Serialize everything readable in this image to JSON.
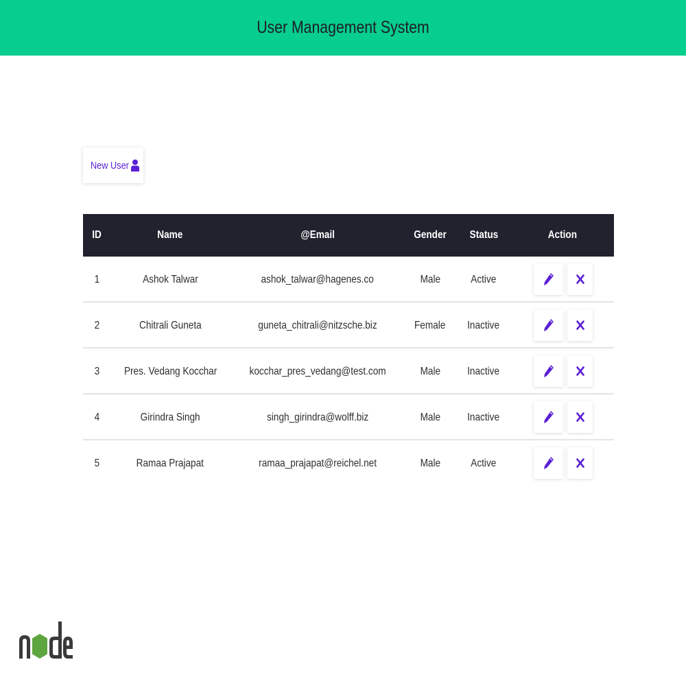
{
  "header": {
    "title": "User Management System",
    "color": "#07cd8d"
  },
  "toolbar": {
    "new_user_label": "New User",
    "new_user_icon": "user-icon",
    "accent": "#5b1fd6"
  },
  "table": {
    "columns": [
      "ID",
      "Name",
      "@Email",
      "Gender",
      "Status",
      "Action"
    ],
    "header_bg": "#21222e",
    "rows": [
      {
        "id": "1",
        "name": "Ashok Talwar",
        "email": "ashok_talwar@hagenes.co",
        "gender": "Male",
        "status": "Active"
      },
      {
        "id": "2",
        "name": "Chitrali Guneta",
        "email": "guneta_chitrali@nitzsche.biz",
        "gender": "Female",
        "status": "Inactive"
      },
      {
        "id": "3",
        "name": "Pres. Vedang Kocchar",
        "email": "kocchar_pres_vedang@test.com",
        "gender": "Male",
        "status": "Inactive"
      },
      {
        "id": "4",
        "name": "Girindra Singh",
        "email": "singh_girindra@wolff.biz",
        "gender": "Male",
        "status": "Inactive"
      },
      {
        "id": "5",
        "name": "Ramaa Prajapat",
        "email": "ramaa_prajapat@reichel.net",
        "gender": "Male",
        "status": "Active"
      }
    ],
    "action_icons": [
      "pencil-icon",
      "close-icon"
    ]
  },
  "footer": {
    "logo": "node-logo"
  }
}
